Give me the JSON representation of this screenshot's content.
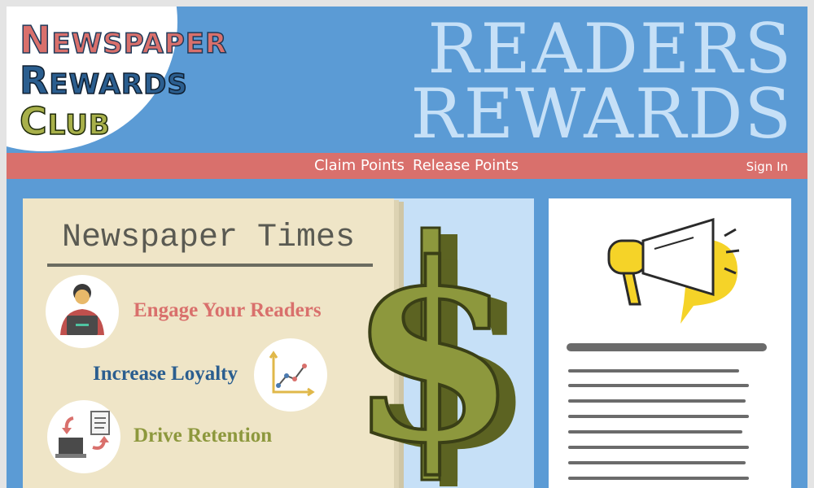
{
  "logo": {
    "line1_initial": "N",
    "line1_rest": "EWSPAPER",
    "line2_initial": "R",
    "line2_rest": "EWARDS",
    "line3_initial": "C",
    "line3_rest": "LUB"
  },
  "hero": {
    "line1": "READERS",
    "line2": "REWARDS"
  },
  "nav": {
    "claim": "Claim Points",
    "release": "Release Points",
    "signin": "Sign In"
  },
  "paper": {
    "title": "Newspaper Times",
    "features": [
      "Engage Your Readers",
      "Increase Loyalty",
      "Drive Retention"
    ]
  },
  "icons": {
    "reader": "reader-at-laptop-icon",
    "loyalty": "growth-chart-icon",
    "retention": "computer-document-exchange-icon",
    "money": "dollar-sign-icon",
    "announce": "megaphone-icon"
  },
  "colors": {
    "header_bg": "#5b9bd5",
    "nav_bg": "#d9706c",
    "accent_red": "#d9706c",
    "accent_blue": "#2b5e8f",
    "accent_olive": "#8d983d",
    "paper_bg": "#efe5c7",
    "megaphone_yellow": "#f5d328"
  }
}
